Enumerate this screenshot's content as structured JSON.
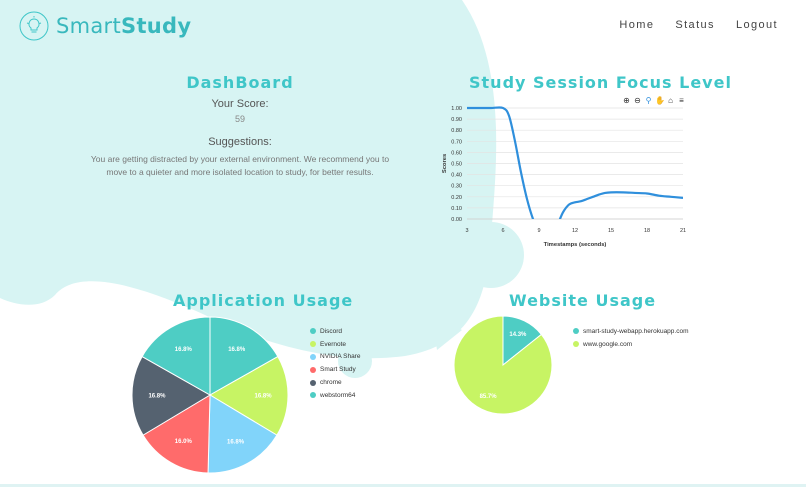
{
  "brand": {
    "name_part1": "Smart",
    "name_part2": "Study"
  },
  "nav": {
    "items": [
      "Home",
      "Status",
      "Logout"
    ]
  },
  "dashboard": {
    "title": "DashBoard",
    "score_label": "Your Score:",
    "score_value": "59",
    "suggestions_label": "Suggestions:",
    "suggestions_text": "You are getting distracted by your external environment. We recommend you to move to a quieter and more isolated location to study, for better results."
  },
  "colors": {
    "accent": "#3fc6c8",
    "line": "#2f8fdc",
    "blob": "#d7f4f3"
  },
  "focus_chart": {
    "title": "Study Session Focus Level",
    "toolbar_icons": [
      "zoom-in-icon",
      "zoom-out-icon",
      "magnify-icon",
      "pan-hand-icon",
      "home-icon",
      "menu-icon"
    ]
  },
  "app_usage": {
    "title": "Application Usage"
  },
  "web_usage": {
    "title": "Website Usage"
  },
  "chart_data": [
    {
      "type": "line",
      "title": "Study Session Focus Level",
      "xlabel": "Timestamps (seconds)",
      "ylabel": "Scores",
      "xlim": [
        3,
        21
      ],
      "ylim": [
        0,
        1
      ],
      "x_ticks": [
        "3",
        "6",
        "9",
        "12",
        "15",
        "18",
        "21"
      ],
      "y_ticks": [
        "0.00",
        "0.10",
        "0.20",
        "0.30",
        "0.40",
        "0.50",
        "0.60",
        "0.70",
        "0.80",
        "0.90",
        "1.00"
      ],
      "grid": true,
      "series": [
        {
          "color": "#2f8fdc",
          "x": [
            3,
            4,
            5,
            6,
            6.5,
            7,
            7.5,
            8,
            8.5,
            9,
            9.5,
            10,
            10.5,
            11,
            11.5,
            12,
            12.5,
            13,
            13.5,
            14,
            14.5,
            15,
            16,
            17,
            18,
            19,
            20,
            21
          ],
          "y": [
            1.0,
            1.0,
            1.0,
            1.0,
            0.93,
            0.7,
            0.42,
            0.18,
            0.0,
            -0.12,
            -0.17,
            -0.14,
            -0.06,
            0.06,
            0.13,
            0.15,
            0.16,
            0.18,
            0.2,
            0.22,
            0.235,
            0.24,
            0.24,
            0.235,
            0.23,
            0.21,
            0.2,
            0.19
          ]
        }
      ]
    },
    {
      "type": "pie",
      "title": "Application Usage",
      "labels": [
        "Discord",
        "Evernote",
        "NVIDIA Share",
        "Smart Study",
        "chrome",
        "webstorm64"
      ],
      "values": [
        16.8,
        16.8,
        16.8,
        16.0,
        16.8,
        16.8
      ],
      "value_labels": [
        "16.8%",
        "16.8%",
        "16.8%",
        "16.0%",
        "16.8%",
        "16.8%"
      ],
      "colors": [
        "#4ecdc4",
        "#c7f464",
        "#81d4fa",
        "#ff6b6b",
        "#556270",
        "#4ecdc4"
      ],
      "legend": "right"
    },
    {
      "type": "pie",
      "title": "Website Usage",
      "labels": [
        "smart-study-webapp.herokuapp.com",
        "www.google.com"
      ],
      "values": [
        14.3,
        85.7
      ],
      "value_labels": [
        "14.3%",
        "85.7%"
      ],
      "colors": [
        "#4ecdc4",
        "#c7f464"
      ],
      "legend": "right"
    }
  ]
}
